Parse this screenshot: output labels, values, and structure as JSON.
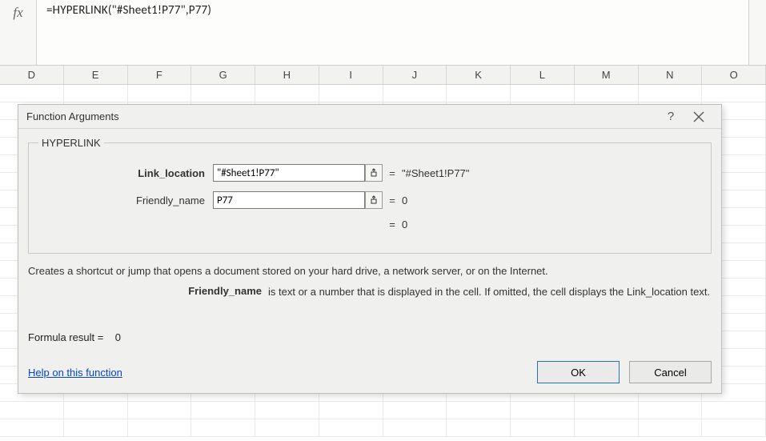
{
  "formula_bar": {
    "fx_label": "fx",
    "formula": "=HYPERLINK(\"#Sheet1!P77\",P77)"
  },
  "columns": [
    "D",
    "E",
    "F",
    "G",
    "H",
    "I",
    "J",
    "K",
    "L",
    "M",
    "N",
    "O"
  ],
  "dialog": {
    "title": "Function Arguments",
    "help_icon": "?",
    "function_name": "HYPERLINK",
    "args": [
      {
        "label": "Link_location",
        "bold": true,
        "value": "\"#Sheet1!P77\"",
        "eq": "=",
        "result": "\"#Sheet1!P77\""
      },
      {
        "label": "Friendly_name",
        "bold": false,
        "value": "P77",
        "eq": "=",
        "result": "0"
      }
    ],
    "overall_eq": "=",
    "overall_result": "0",
    "description": "Creates a shortcut or jump that opens a document stored on your hard drive, a network server, or on the Internet.",
    "param_details": {
      "name": "Friendly_name",
      "desc": "is text or a number that is displayed in the cell. If omitted, the cell displays the Link_location text."
    },
    "formula_result_label": "Formula result =",
    "formula_result_value": "0",
    "help_link": "Help on this function",
    "ok_label": "OK",
    "cancel_label": "Cancel"
  }
}
